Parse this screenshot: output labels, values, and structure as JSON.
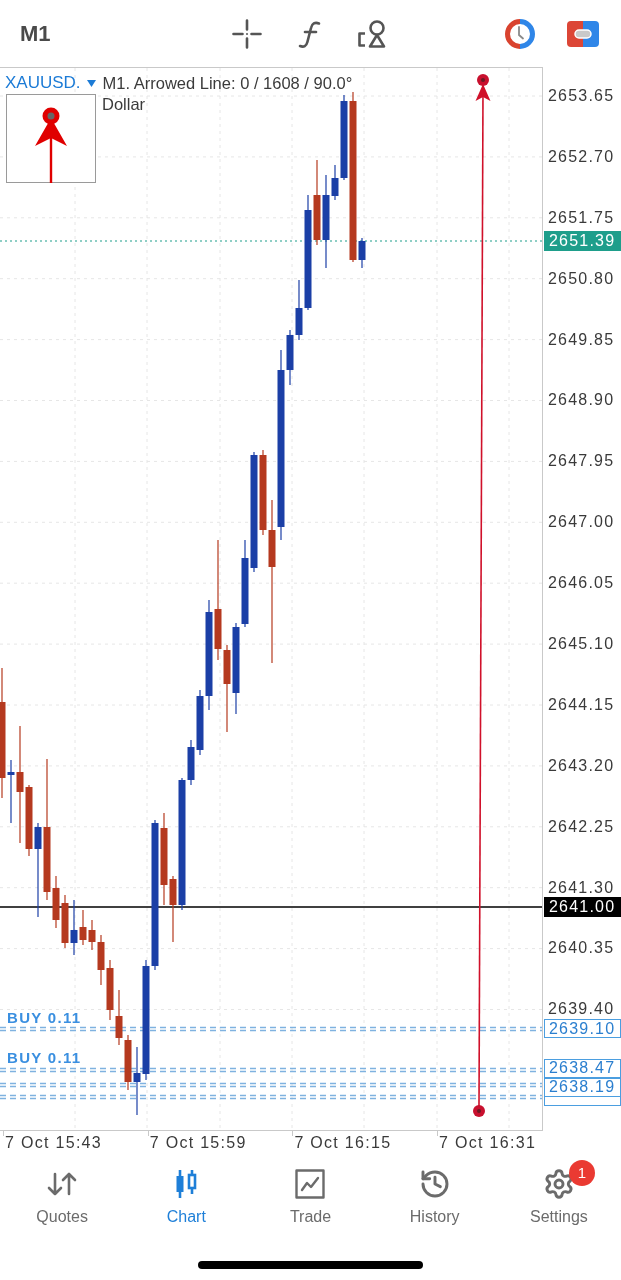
{
  "top_bar": {
    "timeframe": "M1"
  },
  "chart": {
    "symbol": "XAUUSD.",
    "info": "M1. Arrowed Line: 0 / 1608 / 90.0°",
    "description": "Dollar",
    "order_labels": [
      "BUY 0.11",
      "BUY 0.11"
    ]
  },
  "price_axis": {
    "ticks": [
      "2653.65",
      "2652.70",
      "2651.75",
      "2650.80",
      "2649.85",
      "2648.90",
      "2647.95",
      "2647.00",
      "2646.05",
      "2645.10",
      "2644.15",
      "2643.20",
      "2642.25",
      "2641.30",
      "2640.35",
      "2639.40"
    ],
    "tags": [
      {
        "text": "2651.39",
        "kind": "bid"
      },
      {
        "text": "2641.00",
        "kind": "level"
      },
      {
        "text": "2639.10",
        "kind": "order"
      },
      {
        "text": "2638.47",
        "kind": "order"
      },
      {
        "text": "2638.19",
        "kind": "order"
      }
    ]
  },
  "time_axis": {
    "labels": [
      "7 Oct 15:43",
      "7 Oct 15:59",
      "7 Oct 16:15",
      "7 Oct 16:31"
    ]
  },
  "nav": [
    {
      "label": "Quotes",
      "selected": false
    },
    {
      "label": "Chart",
      "selected": true
    },
    {
      "label": "Trade",
      "selected": false
    },
    {
      "label": "History",
      "selected": false
    },
    {
      "label": "Settings",
      "selected": false,
      "badge": "1"
    }
  ]
}
